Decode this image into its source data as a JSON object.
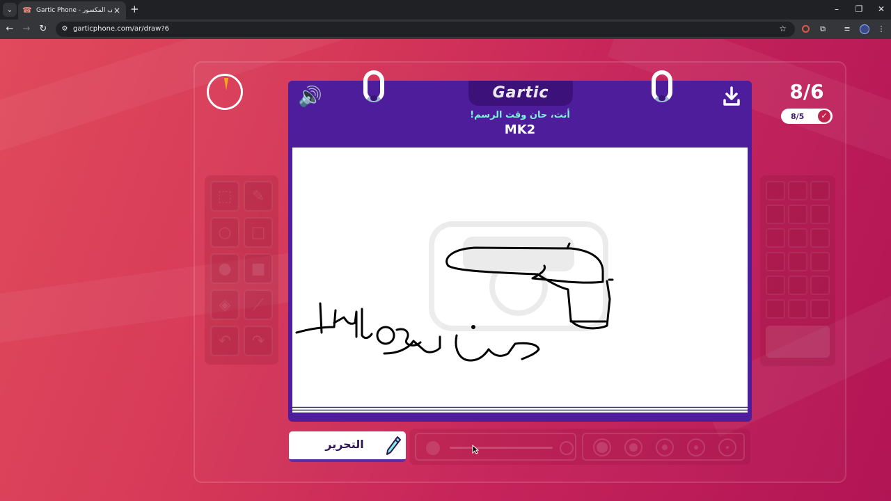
{
  "browser": {
    "tab_title": "Gartic Phone - الهاتف المكسور",
    "tab_favicon": "phone-icon",
    "url": "garticphone.com/ar/draw?6",
    "new_tab_label": "+",
    "colors": {
      "chrome_bg": "#202124",
      "toolbar_bg": "#35363a",
      "text": "#e8eaed"
    }
  },
  "game": {
    "logo": "Gartic",
    "prompt": "أنت، حان وقت الرسم!",
    "word": "MK2",
    "round": "8/6",
    "done_count": "8/5",
    "edit_button_label": "التحرير",
    "colors": {
      "header": "#4e1d9c",
      "prompt": "#7ef3da",
      "background": "#d73a58",
      "timer_hand": "#f2a81d"
    }
  },
  "tools": [
    "eraser-icon",
    "pencil-icon",
    "circle-outline-icon",
    "square-outline-icon",
    "circle-filled-icon",
    "square-filled-icon",
    "fill-bucket-icon",
    "line-icon",
    "undo-icon",
    "redo-icon"
  ],
  "brush": {
    "current_size_fraction": 0.3
  }
}
